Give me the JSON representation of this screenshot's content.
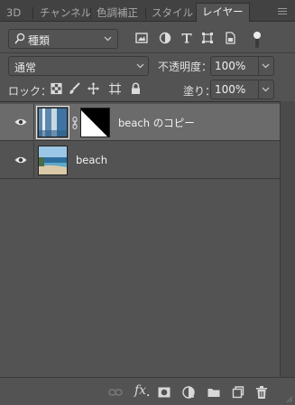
{
  "tabs": [
    {
      "label": "3D"
    },
    {
      "label": "チャンネル"
    },
    {
      "label": "色調補正"
    },
    {
      "label": "スタイル"
    },
    {
      "label": "レイヤー",
      "active": true
    }
  ],
  "filter": {
    "kind_label": "種類",
    "icons": [
      "pixel-filter-icon",
      "adjustment-filter-icon",
      "type-filter-icon",
      "shape-filter-icon",
      "smart-object-filter-icon"
    ]
  },
  "blend": {
    "mode": "通常",
    "opacity_label": "不透明度：",
    "opacity_value": "100%"
  },
  "lock": {
    "label": "ロック：",
    "fill_label": "塗り：",
    "fill_value": "100%",
    "icons": [
      "lock-transparent-icon",
      "lock-brush-icon",
      "lock-move-icon",
      "lock-artboard-icon",
      "lock-all-icon"
    ]
  },
  "layers": [
    {
      "name": "beach のコピー",
      "selected": true,
      "visible": true,
      "has_mask": true
    },
    {
      "name": "beach",
      "selected": false,
      "visible": true,
      "has_mask": false
    }
  ],
  "bottom_bar": {
    "fx_label": "fx",
    "icons": [
      "link-layers-icon",
      "fx-icon",
      "add-mask-icon",
      "adjustment-layer-icon",
      "new-group-icon",
      "new-layer-icon",
      "trash-icon"
    ]
  },
  "colors": {
    "panel_bg": "#535353",
    "tabbar_bg": "#424242",
    "selected_row": "#6b6b6b"
  }
}
